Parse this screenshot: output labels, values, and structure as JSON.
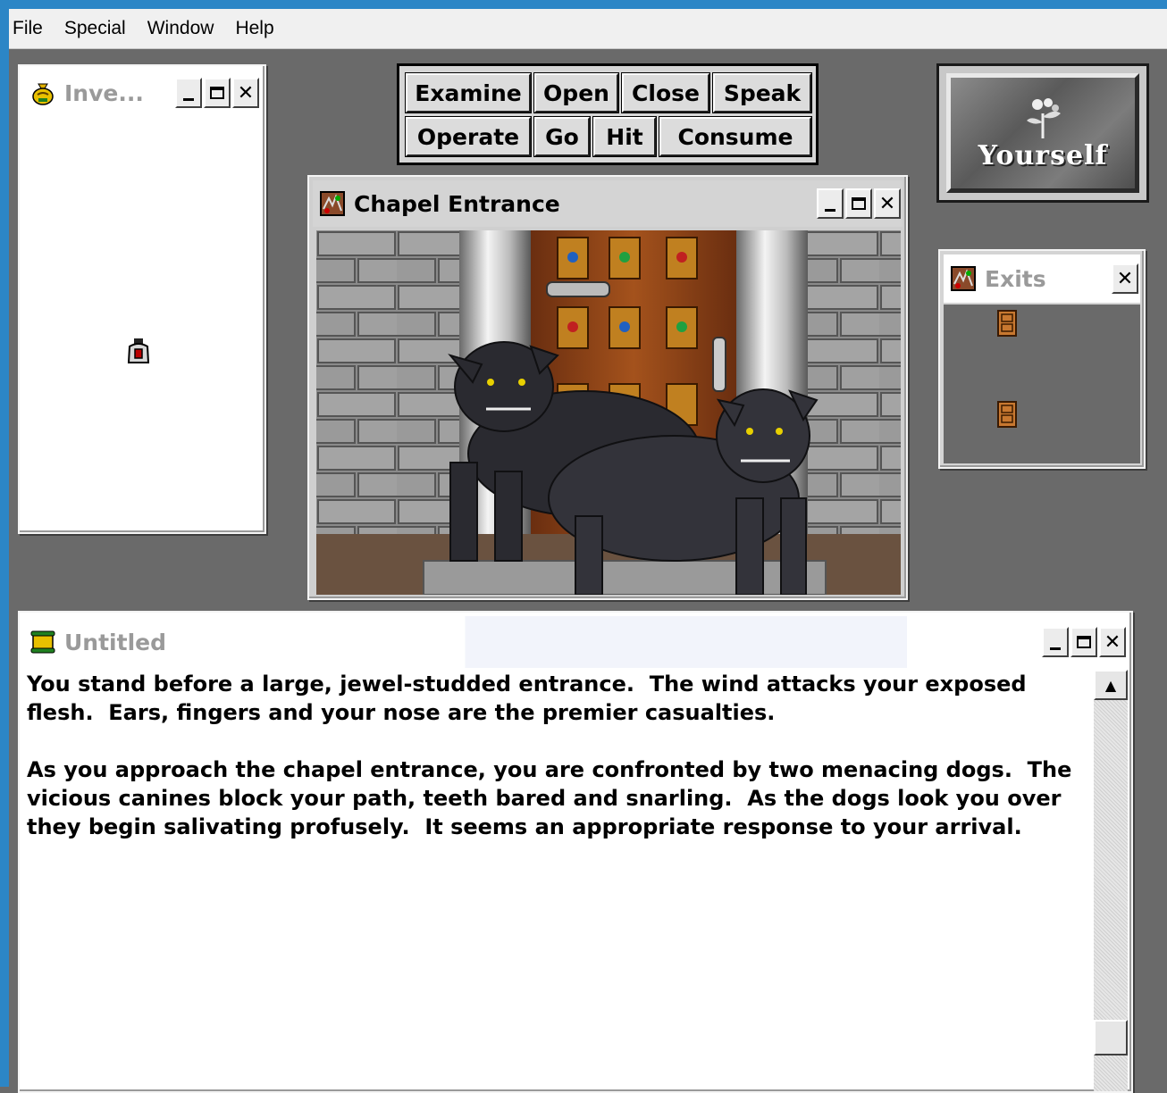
{
  "menubar": {
    "items": [
      "File",
      "Special",
      "Window",
      "Help"
    ]
  },
  "inventory": {
    "title": "Inve...",
    "items": [
      "bag-item-icon"
    ]
  },
  "verbs": {
    "row1": [
      "Examine",
      "Open",
      "Close",
      "Speak"
    ],
    "row2": [
      "Operate",
      "Go",
      "Hit",
      "Consume"
    ]
  },
  "yourself": {
    "label": "Yourself"
  },
  "chapel": {
    "title": "Chapel Entrance",
    "scene": "chapel-entrance-with-two-black-dogs"
  },
  "exits": {
    "title": "Exits",
    "items": [
      "door-icon",
      "door-icon"
    ]
  },
  "textwin": {
    "title": "Untitled",
    "paragraph1": "You stand before a large, jewel-studded entrance.  The wind attacks your exposed flesh.  Ears, fingers and your nose are the premier casualties.",
    "paragraph2": "As you approach the chapel entrance, you are confronted by two menacing dogs.  The vicious canines block your path, teeth bared and snarling.  As the dogs look you over they begin salivating profusely.  It seems an appropriate response to your arrival."
  },
  "colors": {
    "frame": "#2c86c6",
    "desktop": "#6a6a6a",
    "inactive_title": "#9a9a9a"
  }
}
